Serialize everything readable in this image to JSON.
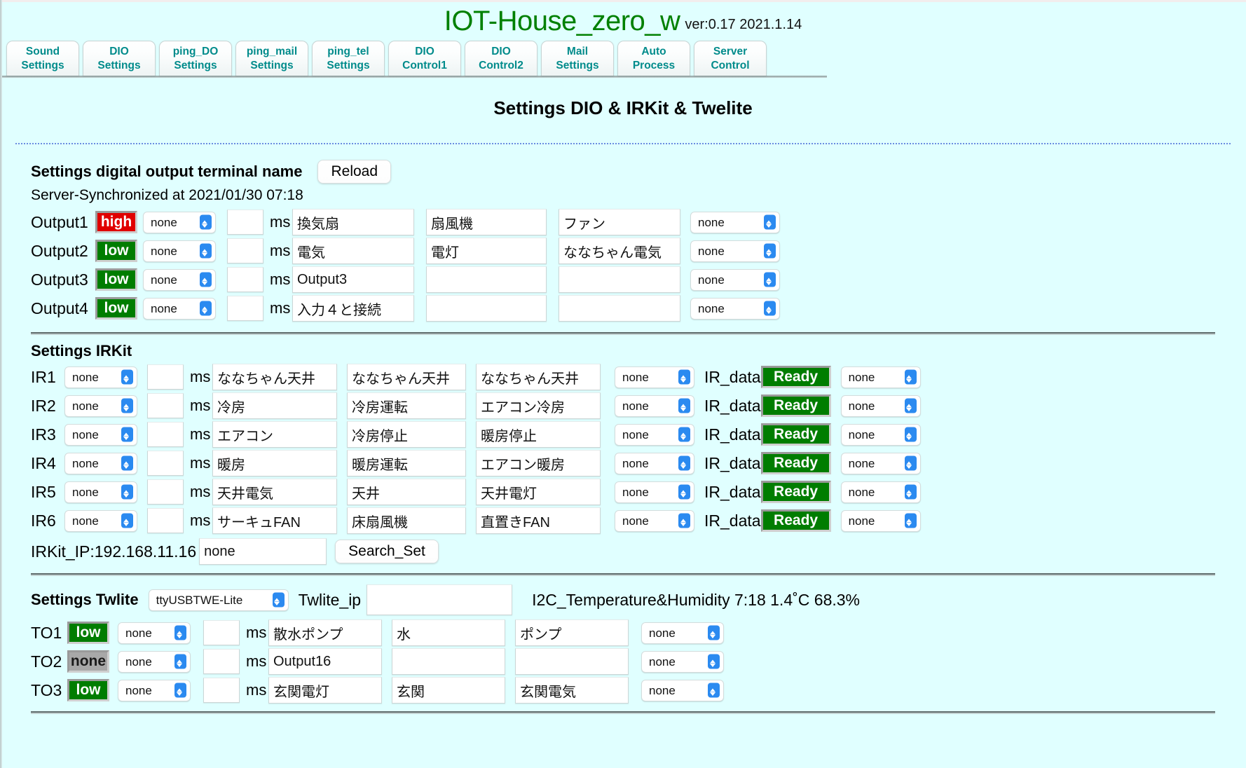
{
  "header": {
    "app_title": "IOT-House_zero_w",
    "version": "ver:0.17 2021.1.14"
  },
  "tabs": [
    {
      "line1": "Sound",
      "line2": "Settings"
    },
    {
      "line1": "DIO",
      "line2": "Settings"
    },
    {
      "line1": "ping_DO",
      "line2": "Settings"
    },
    {
      "line1": "ping_mail",
      "line2": "Settings"
    },
    {
      "line1": "ping_tel",
      "line2": "Settings"
    },
    {
      "line1": "DIO",
      "line2": "Control1"
    },
    {
      "line1": "DIO",
      "line2": "Control2"
    },
    {
      "line1": "Mail",
      "line2": "Settings"
    },
    {
      "line1": "Auto",
      "line2": "Process"
    },
    {
      "line1": "Server",
      "line2": "Control"
    }
  ],
  "page": {
    "heading": "Settings DIO & IRKit & Twelite"
  },
  "dio": {
    "section_title": "Settings digital output terminal name",
    "reload_label": "Reload",
    "sync_text": "Server-Synchronized at 2021/01/30 07:18",
    "ms_label": "ms",
    "rows": [
      {
        "label": "Output1",
        "state": "high",
        "state_color": "red",
        "mode": "none",
        "ms": "",
        "name1": "換気扇",
        "name2": "扇風機",
        "name3": "ファン",
        "action": "none"
      },
      {
        "label": "Output2",
        "state": "low",
        "state_color": "green",
        "mode": "none",
        "ms": "",
        "name1": "電気",
        "name2": "電灯",
        "name3": "ななちゃん電気",
        "action": "none"
      },
      {
        "label": "Output3",
        "state": "low",
        "state_color": "green",
        "mode": "none",
        "ms": "",
        "name1": "Output3",
        "name2": "",
        "name3": "",
        "action": "none"
      },
      {
        "label": "Output4",
        "state": "low",
        "state_color": "green",
        "mode": "none",
        "ms": "",
        "name1": "入力４と接続",
        "name2": "",
        "name3": "",
        "action": "none"
      }
    ]
  },
  "irkit": {
    "section_title": "Settings IRKit",
    "ms_label": "ms",
    "irdata_label": "IR_data",
    "rows": [
      {
        "label": "IR1",
        "mode": "none",
        "ms": "",
        "name1": "ななちゃん天井",
        "name2": "ななちゃん天井",
        "name3": "ななちゃん天井",
        "action": "none",
        "status": "Ready",
        "trailing": "none"
      },
      {
        "label": "IR2",
        "mode": "none",
        "ms": "",
        "name1": "冷房",
        "name2": "冷房運転",
        "name3": "エアコン冷房",
        "action": "none",
        "status": "Ready",
        "trailing": "none"
      },
      {
        "label": "IR3",
        "mode": "none",
        "ms": "",
        "name1": "エアコン",
        "name2": "冷房停止",
        "name3": "暖房停止",
        "action": "none",
        "status": "Ready",
        "trailing": "none"
      },
      {
        "label": "IR4",
        "mode": "none",
        "ms": "",
        "name1": "暖房",
        "name2": "暖房運転",
        "name3": "エアコン暖房",
        "action": "none",
        "status": "Ready",
        "trailing": "none"
      },
      {
        "label": "IR5",
        "mode": "none",
        "ms": "",
        "name1": "天井電気",
        "name2": "天井",
        "name3": "天井電灯",
        "action": "none",
        "status": "Ready",
        "trailing": "none"
      },
      {
        "label": "IR6",
        "mode": "none",
        "ms": "",
        "name1": "サーキュFAN",
        "name2": "床扇風機",
        "name3": "直置きFAN",
        "action": "none",
        "status": "Ready",
        "trailing": "none"
      }
    ],
    "ip_label": "IRKit_IP:192.168.11.16",
    "ip_value": "none",
    "search_label": "Search_Set"
  },
  "twlite": {
    "section_title": "Settings Twlite",
    "device": "ttyUSBTWE-Lite",
    "ip_label": "Twlite_ip",
    "ip_value": "",
    "i2c_text": "I2C_Temperature&Humidity 7:18 1.4˚C 68.3%",
    "ms_label": "ms",
    "rows": [
      {
        "label": "TO1",
        "state": "low",
        "state_color": "green",
        "mode": "none",
        "ms": "",
        "name1": "散水ポンプ",
        "name2": "水",
        "name3": "ポンプ",
        "action": "none"
      },
      {
        "label": "TO2",
        "state": "none",
        "state_color": "grey",
        "mode": "none",
        "ms": "",
        "name1": "Output16",
        "name2": "",
        "name3": "",
        "action": "none"
      },
      {
        "label": "TO3",
        "state": "low",
        "state_color": "green",
        "mode": "none",
        "ms": "",
        "name1": "玄関電灯",
        "name2": "玄関",
        "name3": "玄関電気",
        "action": "none"
      }
    ]
  },
  "colors": {
    "background": "#e0ffff",
    "title_green": "#008000",
    "tab_teal": "#008b8b",
    "status_high": "#e00000",
    "status_low": "#007d00",
    "status_none": "#a8a8a8",
    "accent_blue": "#2b8af0"
  }
}
